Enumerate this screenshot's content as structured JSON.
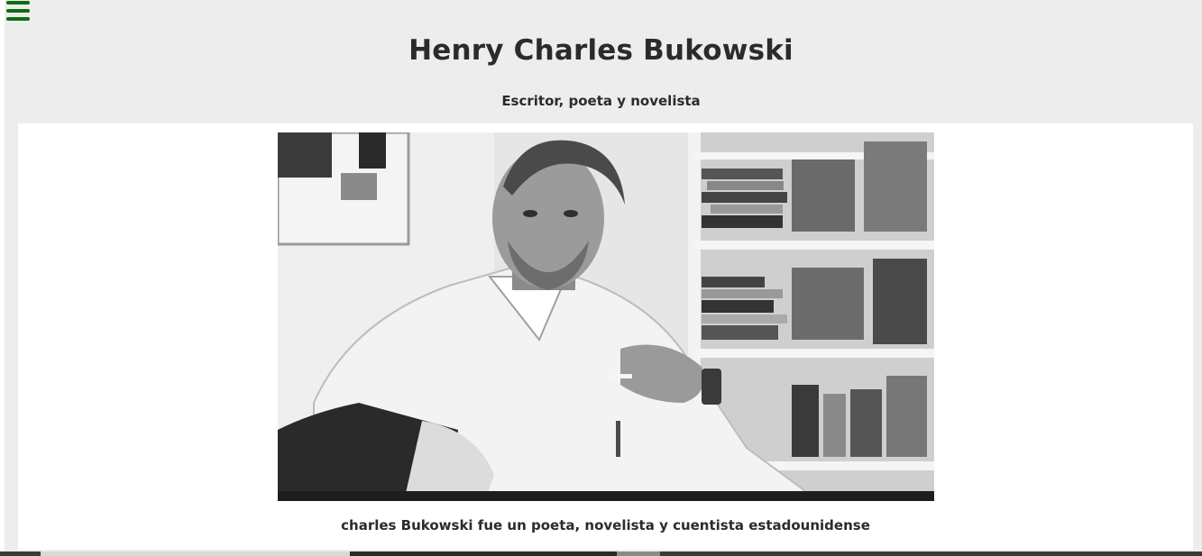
{
  "header": {
    "menu_icon": "hamburger-menu-icon",
    "menu_color": "#0f6b0f",
    "title": "Henry Charles Bukowski",
    "subtitle": "Escritor, poeta y novelista"
  },
  "main": {
    "photo": {
      "description_icon": "portrait-photo"
    },
    "caption": "charles Bukowski fue un poeta, novelista y cuentista estadounidense"
  }
}
